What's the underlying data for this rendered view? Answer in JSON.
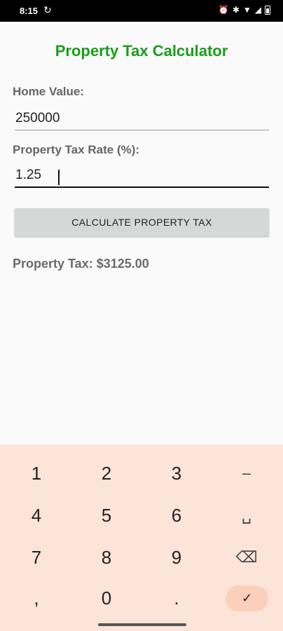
{
  "status_bar": {
    "time": "8:15",
    "sync_icon": "↻",
    "alarm_icon": "⏰",
    "bluetooth_icon": "✱",
    "wifi_icon": "▼",
    "signal_icon": "◢"
  },
  "app": {
    "title": "Property Tax Calculator",
    "title_color": "#1a9d1a"
  },
  "form": {
    "home_value_label": "Home Value:",
    "home_value": "250000",
    "tax_rate_label": "Property Tax Rate (%):",
    "tax_rate": "1.25",
    "button_label": "CALCULATE PROPERTY TAX"
  },
  "result": {
    "text": "Property Tax: $3125.00"
  },
  "keyboard": {
    "keys": [
      [
        "1",
        "2",
        "3",
        "–"
      ],
      [
        "4",
        "5",
        "6",
        "␣"
      ],
      [
        "7",
        "8",
        "9",
        "⌫"
      ],
      [
        ",",
        "0",
        ".",
        "✓"
      ]
    ],
    "background": "#fde4d9",
    "enter_color": "#fccfbb"
  }
}
